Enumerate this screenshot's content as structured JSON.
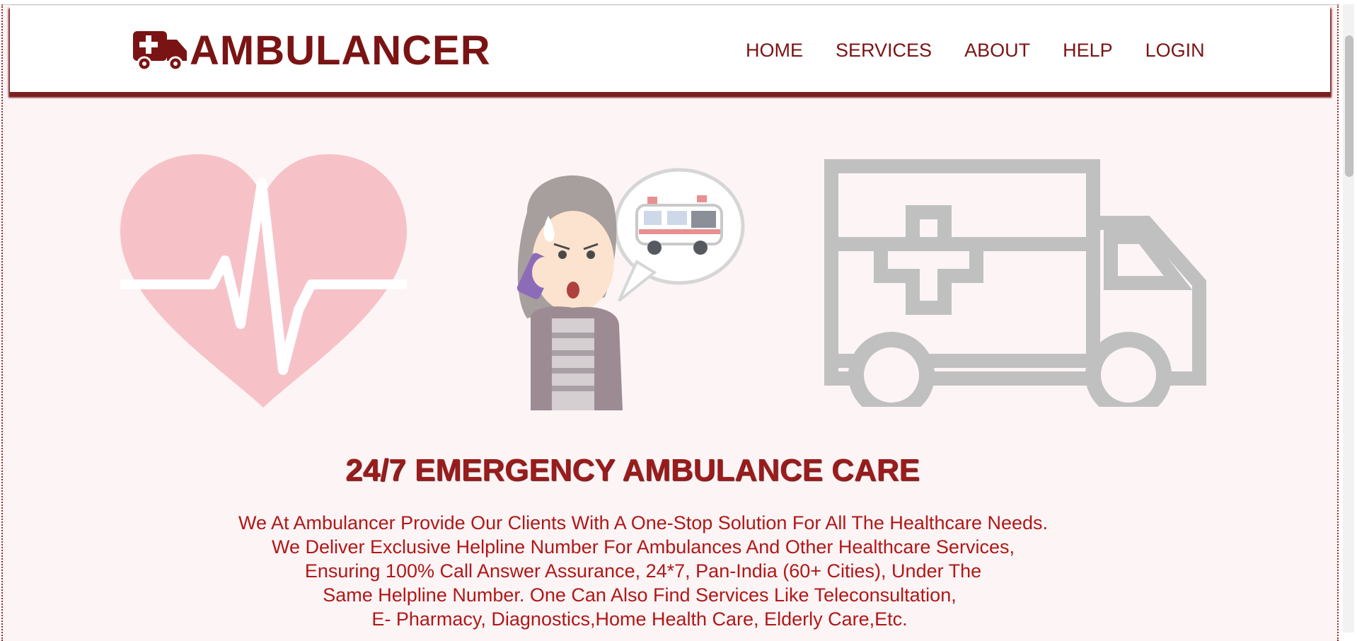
{
  "brand": {
    "name": "AMBULANCER",
    "icon": "ambulance-icon",
    "color": "#7a1414"
  },
  "nav": {
    "items": [
      "HOME",
      "SERVICES",
      "ABOUT",
      "HELP",
      "LOGIN"
    ]
  },
  "hero": {
    "illustrations": [
      "heartbeat-heart-icon",
      "woman-calling-ambulance-illustration",
      "ambulance-outline-icon"
    ]
  },
  "headline": "24/7 EMERGENCY AMBULANCE CARE",
  "body": {
    "lines": [
      "We At Ambulancer Provide Our Clients With A One-Stop Solution For All The Healthcare Needs.",
      "We Deliver Exclusive Helpline Number For Ambulances And Other Healthcare Services,",
      "Ensuring 100% Call Answer Assurance, 24*7, Pan-India (60+ Cities), Under The",
      "Same Helpline Number. One Can Also Find Services Like Teleconsultation,",
      "E- Pharmacy, Diagnostics,Home Health Care, Elderly Care,Etc."
    ]
  },
  "colors": {
    "accent": "#7a1414",
    "text": "#b01818",
    "background": "#fcf4f5"
  }
}
